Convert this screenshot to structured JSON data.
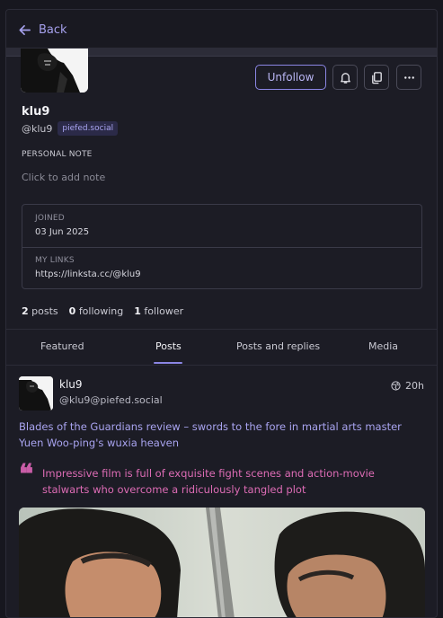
{
  "nav": {
    "back_label": "Back"
  },
  "profile": {
    "display_name": "klu9",
    "handle": "@klu9",
    "instance": "piefed.social",
    "follow_button_label": "Unfollow",
    "personal_note_label": "PERSONAL NOTE",
    "personal_note_placeholder": "Click to add note",
    "fields": [
      {
        "label": "JOINED",
        "value": "03 Jun 2025"
      },
      {
        "label": "MY LINKS",
        "value": "https://linksta.cc/@klu9"
      }
    ],
    "stats": {
      "posts_count": "2",
      "posts_label": "posts",
      "following_count": "0",
      "following_label": "following",
      "followers_count": "1",
      "followers_label": "follower"
    }
  },
  "tabs": [
    {
      "label": "Featured",
      "active": false
    },
    {
      "label": "Posts",
      "active": true
    },
    {
      "label": "Posts and replies",
      "active": false
    },
    {
      "label": "Media",
      "active": false
    }
  ],
  "post": {
    "author_name": "klu9",
    "author_handle": "@klu9@piefed.social",
    "time": "20h",
    "visibility_icon": "globe-icon",
    "title": "Blades of the Guardians review – swords to the fore in martial arts master Yuen Woo-ping's wuxia heaven",
    "quote": "Impressive film is full of exquisite fight scenes and action-movie stalwarts who overcome a ridiculously tangled plot"
  },
  "colors": {
    "accent": "#8b86e4",
    "link": "#a9a4f0",
    "quote": "#dd6cb5",
    "background": "#1c1c25"
  }
}
